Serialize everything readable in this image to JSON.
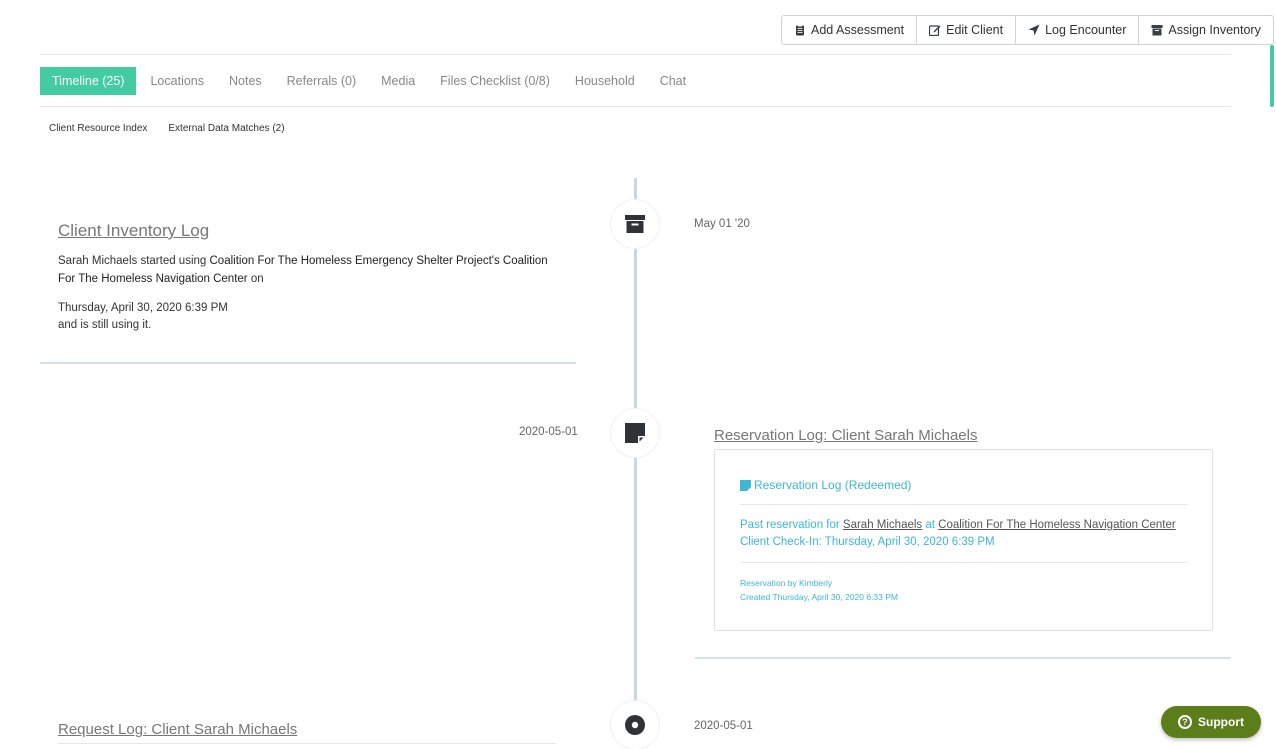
{
  "toolbar": {
    "add_assessment": "Add Assessment",
    "edit_client": "Edit Client",
    "log_encounter": "Log Encounter",
    "assign_inventory": "Assign Inventory"
  },
  "tabs": [
    {
      "label": "Timeline (25)",
      "active": true
    },
    {
      "label": "Locations"
    },
    {
      "label": "Notes"
    },
    {
      "label": "Referrals (0)"
    },
    {
      "label": "Media"
    },
    {
      "label": "Files Checklist (0/8)"
    },
    {
      "label": "Household"
    },
    {
      "label": "Chat"
    }
  ],
  "subtabs": [
    "Client Resource Index",
    "External Data Matches (2)"
  ],
  "timeline": {
    "inventory": {
      "title": "Client Inventory Log",
      "text_prefix": "Sarah Michaels started using ",
      "text_org": "Coalition For The Homeless Emergency Shelter Project's Coalition For The Homeless Navigation Center",
      "text_suffix": " on",
      "date_line": "Thursday, April 30, 2020 6:39 PM",
      "status_line": "and is still using it.",
      "date": "May 01 '20"
    },
    "reservation": {
      "date": "2020-05-01",
      "title": "Reservation Log: Client Sarah Michaels",
      "badge": "Reservation Log (Redeemed)",
      "past_prefix": "Past reservation for ",
      "client_name": "Sarah Michaels",
      "at": " at ",
      "location": "Coalition For The Homeless Navigation Center",
      "checkin": "Client Check-In: Thursday, April 30, 2020 6:39 PM",
      "by": "Reservation by Kimberly",
      "created": "Created Thursday, April 30, 2020 6:33 PM"
    },
    "request": {
      "title": "Request Log: Client Sarah Michaels",
      "date": "2020-05-01"
    }
  },
  "support": {
    "label": "Support"
  },
  "colors": {
    "accent": "#43cba1",
    "teal_text": "#3fb6d6",
    "support_bg": "#5b7d1a"
  }
}
